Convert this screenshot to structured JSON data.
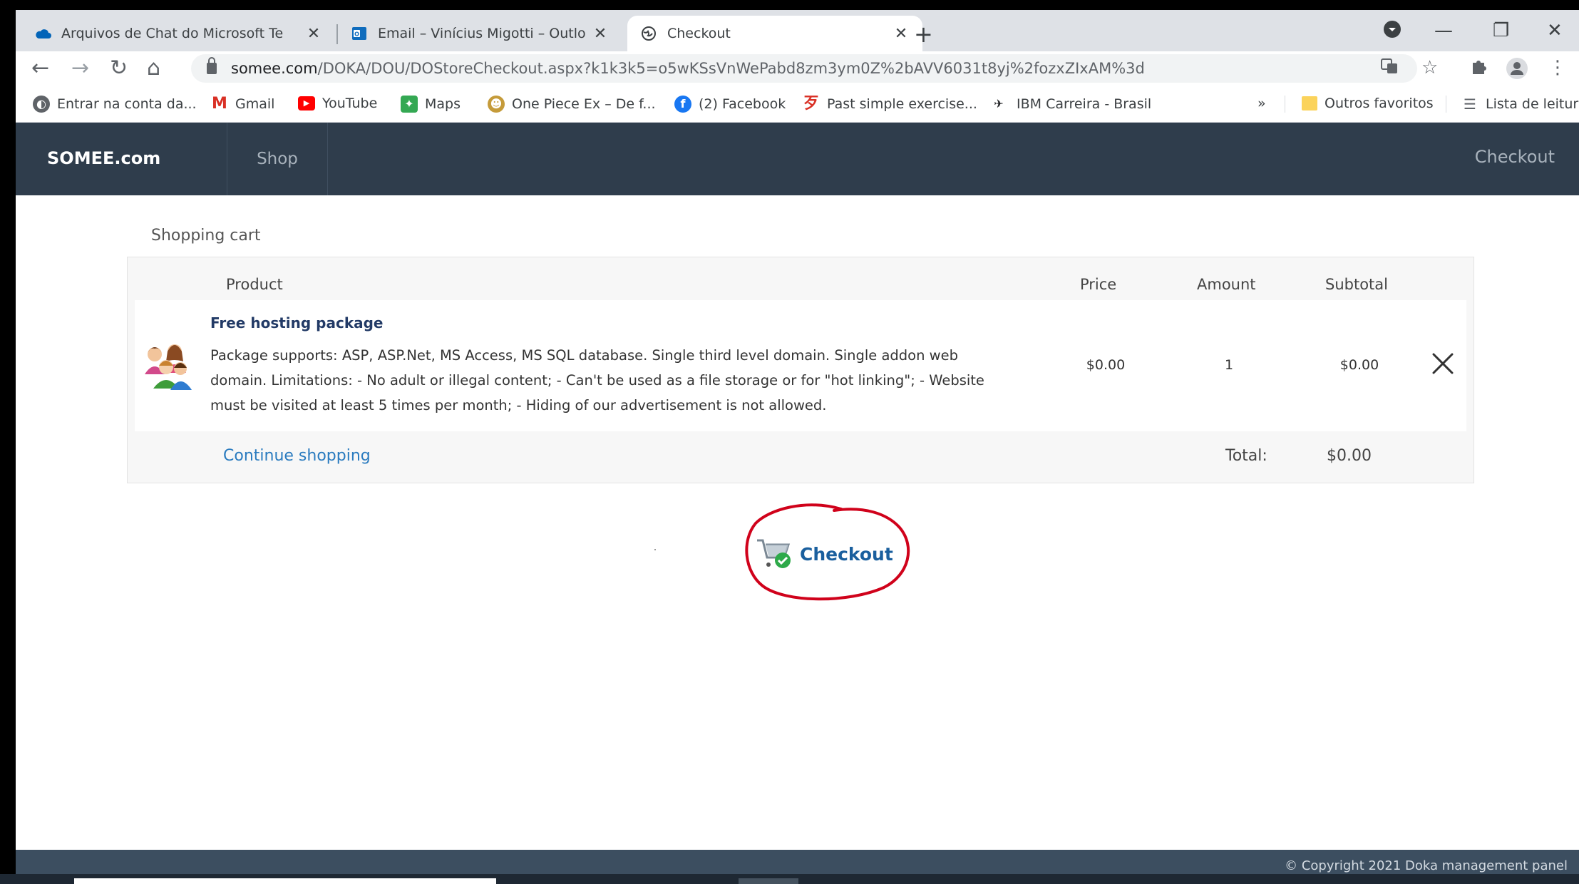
{
  "browser": {
    "tabs": [
      {
        "title": "Arquivos de Chat do Microsoft Te",
        "icon": "onedrive-cloud-icon",
        "active": false
      },
      {
        "title": "Email – Vinícius Migotti – Outlook",
        "icon": "outlook-icon",
        "active": false
      },
      {
        "title": "Checkout",
        "icon": "globe-icon",
        "active": true
      }
    ],
    "url_host": "somee.com",
    "url_path": "/DOKA/DOU/DOStoreCheckout.aspx?k1k3k5=o5wKSsVnWePabd8zm3ym0Z%2bAVV6031t8yj%2fozxZIxAM%3d",
    "bookmarks": [
      {
        "label": "Entrar na conta da...",
        "icon": "globe-icon",
        "color": "#5f6368"
      },
      {
        "label": "Gmail",
        "icon": "gmail-icon",
        "color": "#d93025"
      },
      {
        "label": "YouTube",
        "icon": "youtube-icon",
        "color": "#ff0000"
      },
      {
        "label": "Maps",
        "icon": "maps-icon",
        "color": "#34a853"
      },
      {
        "label": "One Piece Ex – De f...",
        "icon": "one-piece-icon",
        "color": "#c59b3a"
      },
      {
        "label": "(2) Facebook",
        "icon": "facebook-icon",
        "color": "#1877f2"
      },
      {
        "label": "Past simple exercise...",
        "icon": "past-simple-icon",
        "color": "#d93025"
      },
      {
        "label": "IBM Carreira - Brasil",
        "icon": "ibm-icon",
        "color": "#202124"
      }
    ],
    "more_bookmarks": "»",
    "other_favorites": "Outros favoritos",
    "reading_list": "Lista de leitura"
  },
  "site": {
    "brand": "SOMEE.com",
    "nav_shop": "Shop",
    "nav_checkout": "Checkout"
  },
  "cart": {
    "title": "Shopping cart",
    "headers": {
      "product": "Product",
      "price": "Price",
      "amount": "Amount",
      "subtotal": "Subtotal"
    },
    "item": {
      "name": "Free hosting package",
      "description": "Package supports: ASP, ASP.Net, MS Access, MS SQL database. Single third level domain. Single addon web domain. Limitations: - No adult or illegal content; - Can't be used as a file storage or for \"hot linking\"; - Website must be visited at least 5 times per month; - Hiding of our advertisement is not allowed.",
      "price": "$0.00",
      "amount": "1",
      "subtotal": "$0.00"
    },
    "continue_shopping": "Continue shopping",
    "total_label": "Total:",
    "total_value": "$0.00",
    "checkout_button": "Checkout"
  },
  "footer": {
    "copyright": "© Copyright 2021 Doka management panel"
  },
  "colors": {
    "nav_bg": "#2f3d4c",
    "link": "#2a7bbf",
    "annotation_circle": "#d0021b"
  }
}
